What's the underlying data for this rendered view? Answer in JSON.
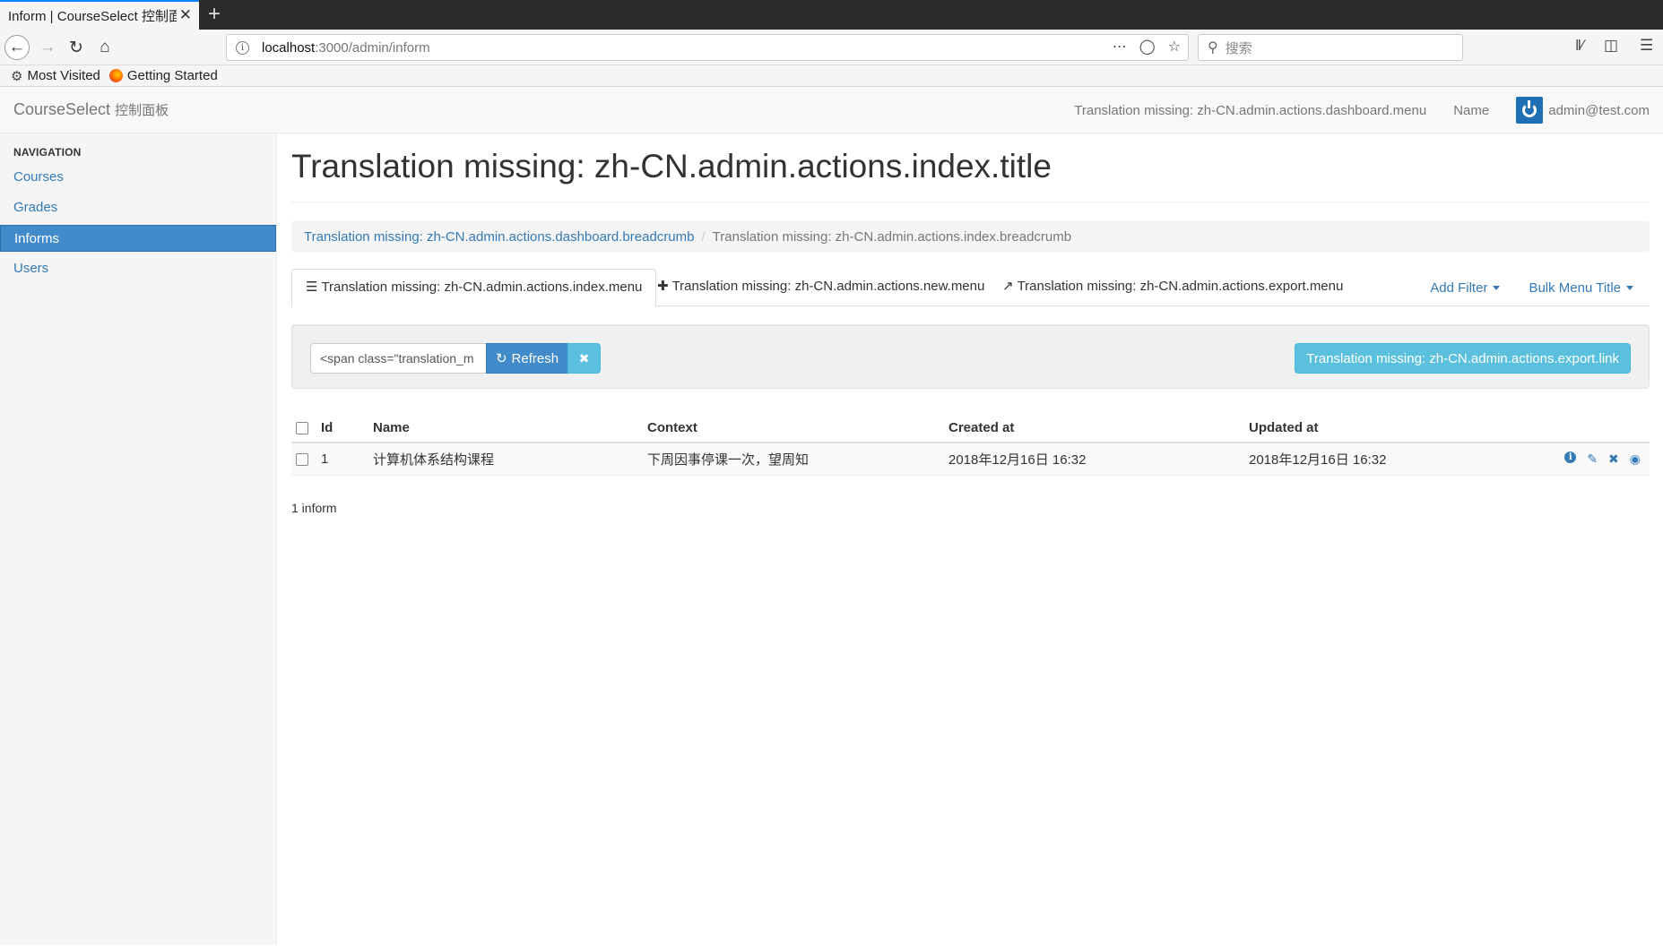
{
  "browser": {
    "tab_title": "Inform | CourseSelect 控制面板",
    "tab_close": "✕",
    "new_tab": "+",
    "url_host": "localhost",
    "url_path": ":3000/admin/inform",
    "search_placeholder": "搜索",
    "bookmarks": [
      "Most Visited",
      "Getting Started"
    ]
  },
  "app": {
    "brand": "CourseSelect",
    "brand_sub": "控制面板",
    "nav_dashboard": "Translation missing: zh-CN.admin.actions.dashboard.menu",
    "nav_name": "Name",
    "user_email": "admin@test.com"
  },
  "sidebar": {
    "header": "NAVIGATION",
    "items": [
      {
        "label": "Courses"
      },
      {
        "label": "Grades"
      },
      {
        "label": "Informs"
      },
      {
        "label": "Users"
      }
    ]
  },
  "main": {
    "title": "Translation missing: zh-CN.admin.actions.index.title",
    "breadcrumb": {
      "link": "Translation missing: zh-CN.admin.actions.dashboard.breadcrumb",
      "sep": "/",
      "active": "Translation missing: zh-CN.admin.actions.index.breadcrumb"
    },
    "tabs": [
      {
        "label": "Translation missing: zh-CN.admin.actions.index.menu",
        "icon": "list-icon"
      },
      {
        "label": "Translation missing: zh-CN.admin.actions.new.menu",
        "icon": "plus-icon"
      },
      {
        "label": "Translation missing: zh-CN.admin.actions.export.menu",
        "icon": "share-icon"
      }
    ],
    "add_filter": "Add Filter",
    "bulk_menu": "Bulk Menu Title",
    "query_value": "<span class=\"translation_m",
    "refresh_label": "Refresh",
    "export_link": "Translation missing: zh-CN.admin.actions.export.link",
    "table": {
      "columns": [
        "Id",
        "Name",
        "Context",
        "Created at",
        "Updated at"
      ],
      "rows": [
        {
          "id": "1",
          "name": "计算机体系结构课程",
          "context": "下周因事停课一次，望周知",
          "created_at": "2018年12月16日 16:32",
          "updated_at": "2018年12月16日 16:32"
        }
      ]
    },
    "count": "1 inform"
  },
  "colors": {
    "accent": "#428bca",
    "info": "#5bc0de",
    "link": "#337ab7"
  }
}
